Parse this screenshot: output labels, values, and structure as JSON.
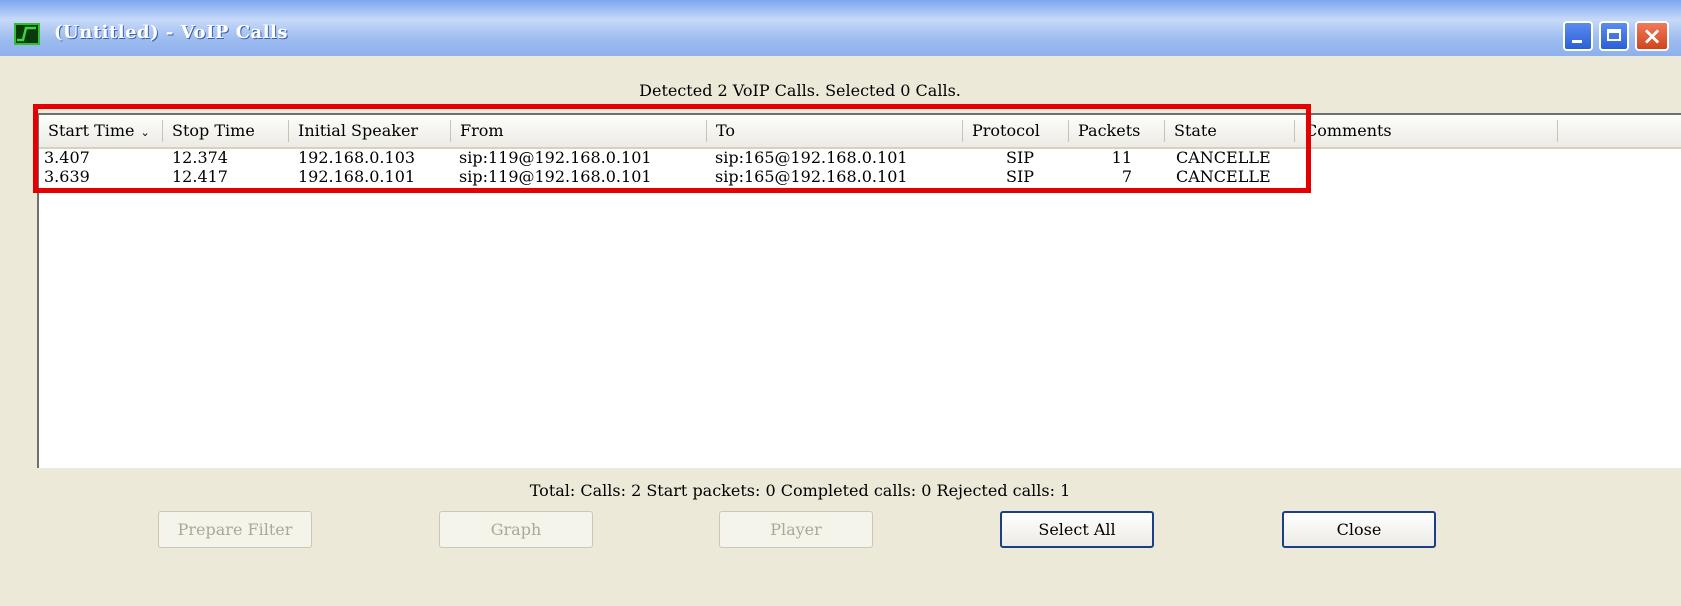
{
  "window": {
    "title": "(Untitled) - VoIP Calls"
  },
  "detected_label": "Detected 2 VoIP Calls. Selected 0 Calls.",
  "table": {
    "columns": [
      "Start Time",
      "Stop Time",
      "Initial Speaker",
      "From",
      "To",
      "Protocol",
      "Packets",
      "State",
      "Comments"
    ],
    "sort_indicator": "⌄",
    "rows": [
      {
        "start": "3.407",
        "stop": "12.374",
        "speaker": "192.168.0.103",
        "from": "sip:119@192.168.0.101",
        "to": "sip:165@192.168.0.101",
        "protocol": "SIP",
        "packets": "11",
        "state": "CANCELLE",
        "comments": ""
      },
      {
        "start": "3.639",
        "stop": "12.417",
        "speaker": "192.168.0.101",
        "from": "sip:119@192.168.0.101",
        "to": "sip:165@192.168.0.101",
        "protocol": "SIP",
        "packets": "7",
        "state": "CANCELLE",
        "comments": ""
      }
    ]
  },
  "stats_label": "Total: Calls: 2   Start packets: 0   Completed calls: 0   Rejected calls: 1",
  "buttons": {
    "prepare_filter": "Prepare Filter",
    "graph": "Graph",
    "player": "Player",
    "select_all": "Select All",
    "close": "Close"
  },
  "colors": {
    "highlight": "#e40000",
    "titlebar": "#9dbcf0",
    "dialog_bg": "#ece9d8"
  },
  "icons": {
    "app": "wireshark-icon",
    "minimize": "minimize-icon",
    "maximize": "maximize-icon",
    "close": "close-icon"
  }
}
